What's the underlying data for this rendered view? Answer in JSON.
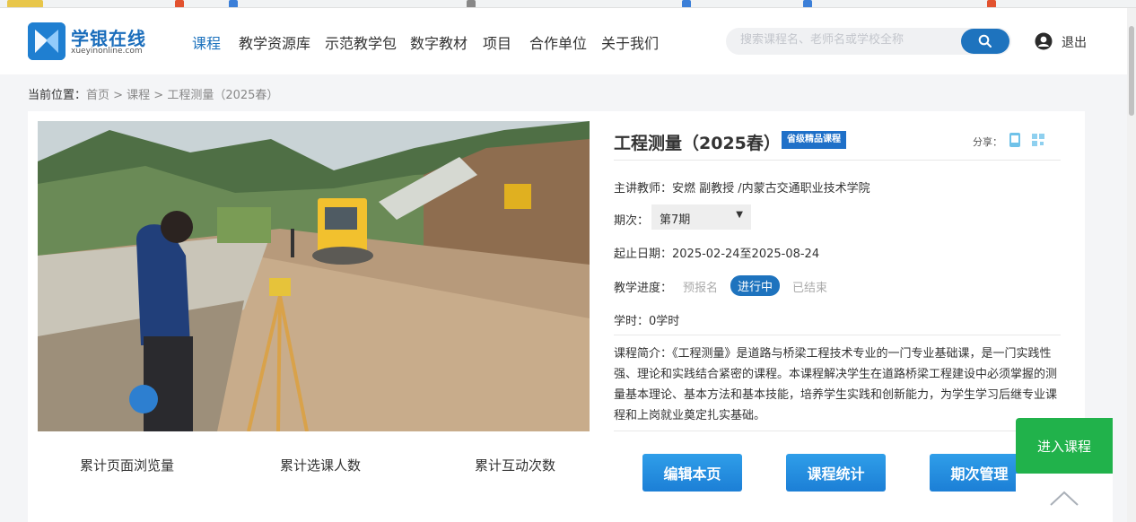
{
  "site": {
    "logo_title": "学银在线",
    "logo_sub": "xueyinonline.com"
  },
  "nav": {
    "items": [
      "课程",
      "教学资源库",
      "示范教学包",
      "数字教材",
      "项目",
      "合作单位",
      "关于我们"
    ],
    "active_index": 0
  },
  "search": {
    "placeholder": "搜索课程名、老师名或学校全称",
    "icon": "search-icon"
  },
  "user": {
    "logout_label": "退出"
  },
  "breadcrumb": {
    "label": "当前位置：",
    "path": "首页 > 课程 > 工程测量（2025春）"
  },
  "course": {
    "title": "工程测量（2025春）",
    "badge": "省级精品课程",
    "share_label": "分享：",
    "teacher": "主讲教师：安燃 副教授 /内蒙古交通职业技术学院",
    "term_label": "期次：",
    "term_value": "第7期",
    "dates": "起止日期：2025-02-24至2025-08-24",
    "progress_label": "教学进度：",
    "progress_steps": [
      "预报名",
      "进行中",
      "已结束"
    ],
    "progress_current": "进行中",
    "hours": "学时：0学时",
    "description": "课程简介：《工程测量》是道路与桥梁工程技术专业的一门专业基础课，是一门实践性强、理论和实践结合紧密的课程。本课程解决学生在道路桥梁工程建设中必须掌握的测量基本理论、基本方法和基本技能，培养学生实践和创新能力，为学生学习后继专业课程和上岗就业奠定扎实基础。"
  },
  "stats": {
    "labels": [
      "累计页面浏览量",
      "累计选课人数",
      "累计互动次数"
    ]
  },
  "actions": {
    "edit": "编辑本页",
    "statistics": "课程统计",
    "term_manage": "期次管理",
    "enter_course": "进入课程"
  },
  "colors": {
    "brand_blue": "#1e73be",
    "enter_green": "#21b24b",
    "badge_blue": "#1f70c8"
  }
}
